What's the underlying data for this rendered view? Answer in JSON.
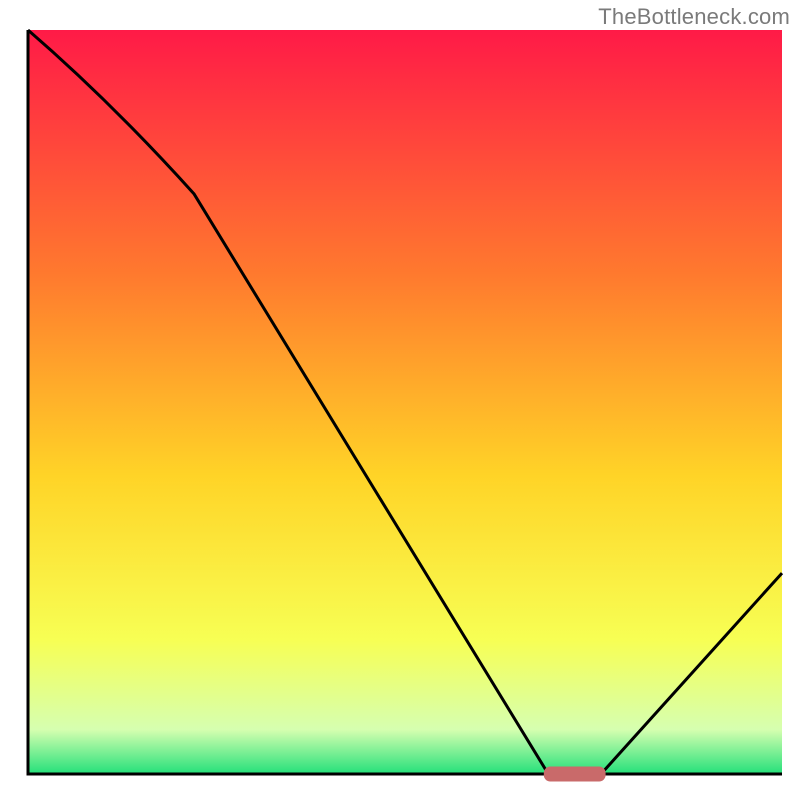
{
  "watermark": "TheBottleneck.com",
  "colors": {
    "axis": "#000000",
    "curve": "#000000",
    "marker_fill": "#c96a6a",
    "marker_stroke": "#c96a6a",
    "gradient": {
      "top": "#ff1a47",
      "q1": "#ff7a2e",
      "mid": "#ffd427",
      "q3": "#f7ff54",
      "low": "#d6ffb0",
      "bottom": "#24e07a"
    }
  },
  "chart_data": {
    "type": "line",
    "title": "",
    "xlabel": "",
    "ylabel": "",
    "xlim": [
      0,
      100
    ],
    "ylim": [
      0,
      100
    ],
    "series": [
      {
        "name": "bottleneck-curve",
        "x": [
          0,
          22,
          69,
          76,
          100
        ],
        "values": [
          100,
          78,
          0,
          0,
          27
        ]
      }
    ],
    "marker": {
      "x_start": 69,
      "x_end": 76,
      "y": 0
    },
    "annotations": []
  }
}
